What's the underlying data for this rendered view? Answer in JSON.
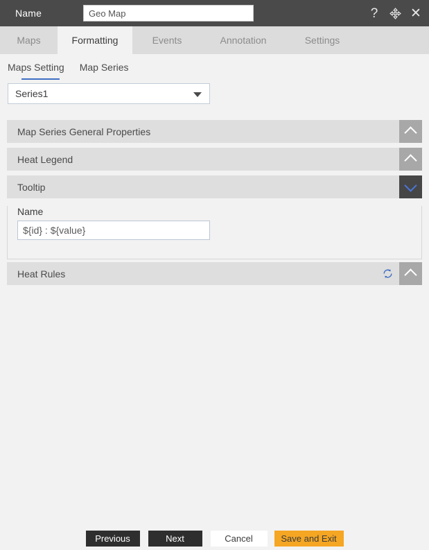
{
  "titlebar": {
    "label": "Name",
    "name_value": "Geo Map",
    "name_placeholder": "Name",
    "help_icon": "question-mark-icon",
    "move_icon": "move-arrows-icon",
    "close_icon": "close-icon"
  },
  "tabs": [
    {
      "label": "Maps",
      "active": false
    },
    {
      "label": "Formatting",
      "active": true
    },
    {
      "label": "Events",
      "active": false
    },
    {
      "label": "Annotation",
      "active": false
    },
    {
      "label": "Settings",
      "active": false
    }
  ],
  "subnav": [
    {
      "label": "Maps Setting",
      "active": false
    },
    {
      "label": "Map Series",
      "active": true
    }
  ],
  "series_select": {
    "value": "Series1",
    "options": [
      "Series1"
    ]
  },
  "panels": [
    {
      "title": "Map Series General Properties",
      "expanded": false
    },
    {
      "title": "Heat Legend",
      "expanded": false
    },
    {
      "title": "Tooltip",
      "expanded": true
    },
    {
      "title": "Heat Rules",
      "expanded": false,
      "has_sync": true
    }
  ],
  "tooltip_section": {
    "field_label": "Name",
    "field_value": "${id} : ${value}",
    "field_placeholder": "${id} : ${value}"
  },
  "footer": {
    "previous": "Previous",
    "next": "Next",
    "cancel": "Cancel",
    "save_and_exit": "Save and Exit"
  },
  "colors": {
    "titlebar": "#4a4a4a",
    "tabbar": "#dcdcdc",
    "body": "#f2f2f2",
    "panel_header": "#dedede",
    "toggle_collapsed": "#a8a8a8",
    "toggle_expanded": "#464646",
    "accent_blue": "#3f6fc4",
    "accent_orange": "#f5a623",
    "button_dark": "#2e2e2e"
  }
}
